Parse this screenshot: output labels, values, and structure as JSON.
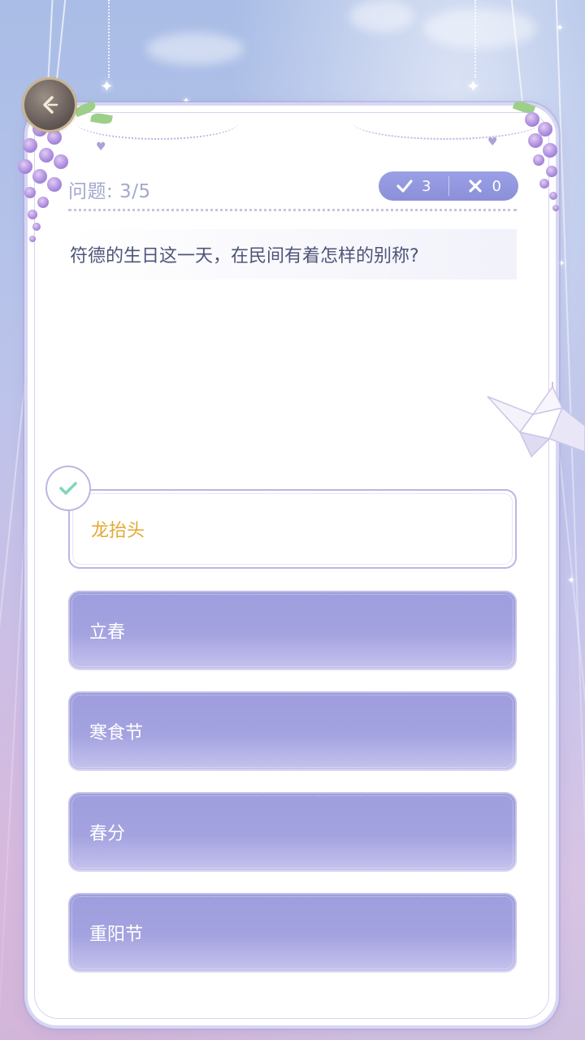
{
  "header": {
    "question_counter": "问题: 3/5",
    "correct_count": "3",
    "wrong_count": "0"
  },
  "question": {
    "text": "符德的生日这一天，在民间有着怎样的别称?"
  },
  "answers": [
    {
      "label": "龙抬头",
      "state": "selected"
    },
    {
      "label": "立春",
      "state": "normal"
    },
    {
      "label": "寒食节",
      "state": "normal"
    },
    {
      "label": "春分",
      "state": "normal"
    },
    {
      "label": "重阳节",
      "state": "normal"
    }
  ],
  "icons": {
    "back": "back-arrow-icon",
    "correct": "check-icon",
    "wrong": "cross-icon",
    "selected_mark": "check-icon"
  },
  "colors": {
    "accent": "#8b8fd9",
    "answer_fill": "#a4a3e0",
    "selected_text": "#e3a935",
    "check_green": "#7fd6b8",
    "question_text": "#4e5578"
  }
}
